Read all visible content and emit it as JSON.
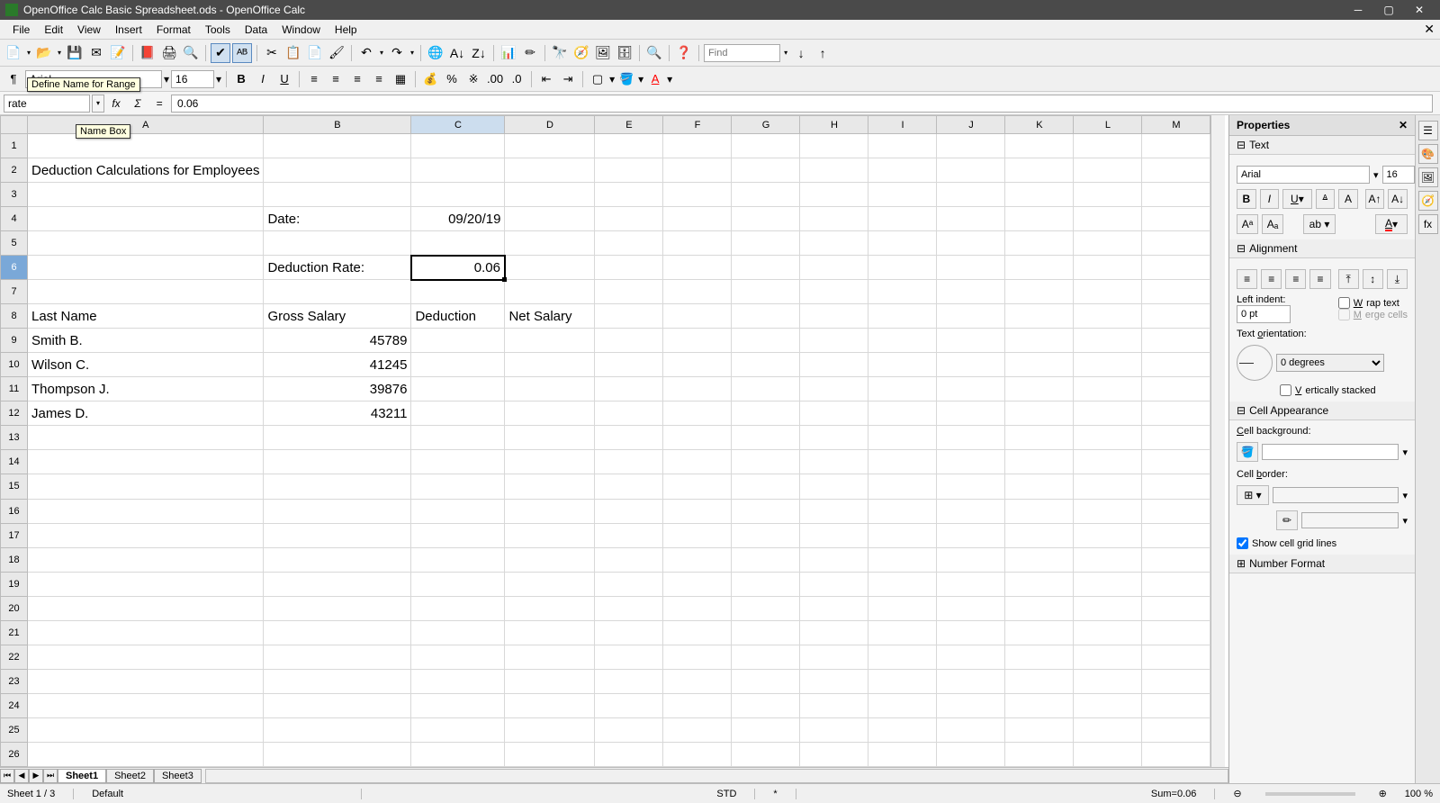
{
  "window": {
    "title": "OpenOffice Calc Basic Spreadsheet.ods - OpenOffice Calc"
  },
  "menu": [
    "File",
    "Edit",
    "View",
    "Insert",
    "Format",
    "Tools",
    "Data",
    "Window",
    "Help"
  ],
  "toolbar": {
    "find_placeholder": "Find"
  },
  "format": {
    "font": "Arial",
    "size": "16"
  },
  "formulabar": {
    "namebox": "rate",
    "formula": "0.06",
    "tooltip1": "Define Name for Range",
    "tooltip2": "Name Box"
  },
  "columns": [
    "A",
    "B",
    "C",
    "D",
    "E",
    "F",
    "G",
    "H",
    "I",
    "J",
    "K",
    "L",
    "M"
  ],
  "cells": {
    "A2": "Deduction Calculations for Employees",
    "B4": "Date:",
    "C4": "09/20/19",
    "B6": "Deduction Rate:",
    "C6": "0.06",
    "A8": "Last Name",
    "B8": "Gross Salary",
    "C8": "Deduction",
    "D8": "Net Salary",
    "A9": "Smith B.",
    "B9": "45789",
    "A10": "Wilson C.",
    "B10": "41245",
    "A11": "Thompson J.",
    "B11": "39876",
    "A12": "James D.",
    "B12": "43211"
  },
  "selected": {
    "col": "C",
    "row": 6
  },
  "tabs": [
    "Sheet1",
    "Sheet2",
    "Sheet3"
  ],
  "active_tab": 0,
  "sidebar": {
    "title": "Properties",
    "text": {
      "hdr": "Text",
      "font": "Arial",
      "size": "16"
    },
    "alignment": {
      "hdr": "Alignment",
      "leftindent_lbl": "Left indent:",
      "leftindent_val": "0 pt",
      "wrap": "Wrap text",
      "merge": "Merge cells",
      "orient_lbl": "Text orientation:",
      "orient_val": "0 degrees",
      "vert": "Vertically stacked"
    },
    "appearance": {
      "hdr": "Cell Appearance",
      "bg": "Cell background:",
      "border": "Cell border:",
      "grid": "Show cell grid lines"
    },
    "numfmt": {
      "hdr": "Number Format"
    }
  },
  "statusbar": {
    "sheet": "Sheet 1 / 3",
    "style": "Default",
    "mode": "STD",
    "sum": "Sum=0.06",
    "zoom": "100 %"
  }
}
